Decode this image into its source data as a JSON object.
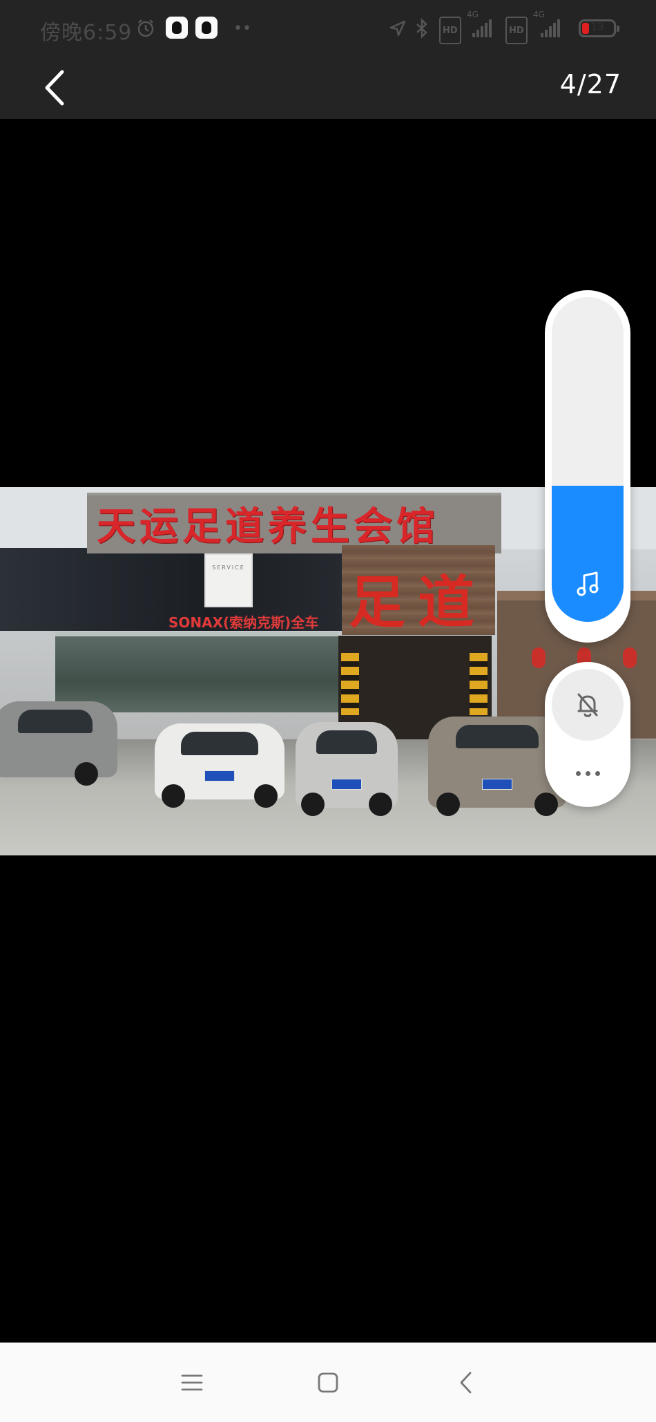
{
  "status_bar": {
    "time": "傍晚6:59",
    "alarm_icon": "alarm-clock-icon",
    "notification_icons": [
      "qq-icon",
      "qq-icon"
    ],
    "more_notifications": "••",
    "right_icons": [
      "location-arrow-icon",
      "bluetooth-icon",
      "hd-icon",
      "signal-4g-icon",
      "hd-icon",
      "signal-4g-icon"
    ],
    "hd_label": "HD",
    "network_label": "4G",
    "battery_level": "13",
    "battery_color": "#e02020"
  },
  "top_nav": {
    "back_icon": "chevron-left-icon",
    "page_counter": "4/27"
  },
  "photo": {
    "description_icon": "storefront-photo",
    "sign_text": "天运足道养生会馆",
    "service_card_text": "SERVICE",
    "sonax_text": "SONAX(索纳克斯)全车",
    "wood_sign_text": "足道"
  },
  "volume_widget": {
    "level_percent": 42,
    "fill_color": "#1a8cff",
    "music_icon": "music-note-icon",
    "mute_icon": "bell-off-icon",
    "more_icon": "more-horizontal-icon"
  },
  "nav_bar": {
    "menu_icon": "menu-lines-icon",
    "home_icon": "home-square-icon",
    "back_icon": "back-chevron-icon"
  }
}
